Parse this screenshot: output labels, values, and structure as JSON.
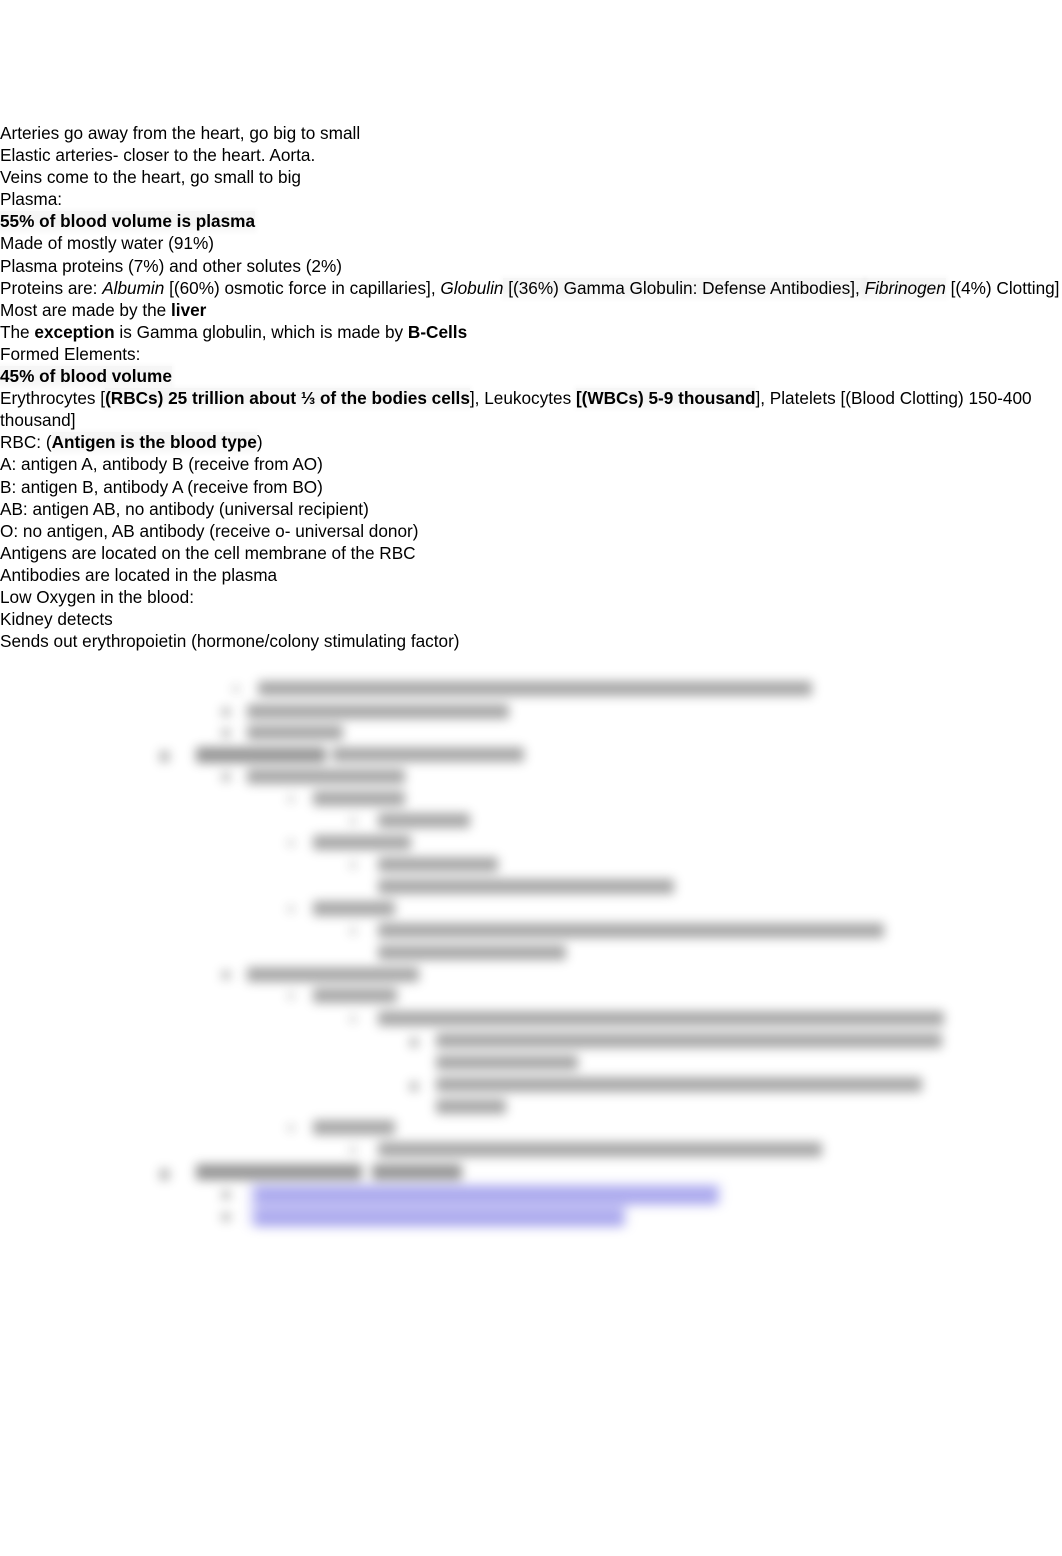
{
  "document": {
    "title": "Blood & Cardiovascular Study Notes",
    "page_background": "#ffffff",
    "text_color": "#000000",
    "highlight_color": "#8f8bf0",
    "blur_note": "lower portion of the page is heavily blurred and unreadable"
  },
  "bullets": {
    "level1": "➔",
    "level2": "◆",
    "level3": "●",
    "level4": "○"
  },
  "outline": {
    "arteries": "Arteries go away from the heart, go big to small",
    "arteries_sub": "Elastic arteries- closer to the heart. Aorta.",
    "veins": "Veins come to the heart, go small to big",
    "plasma_heading": "Plasma:",
    "plasma_volume": "55% of blood volume is plasma",
    "plasma_water": "Made of mostly water (91%)",
    "plasma_proteins": "Plasma proteins (7%)  and other solutes (2%)",
    "proteins_lead": "Proteins are: ",
    "proteins_albumin": "Albumin",
    "proteins_albumin_tail": " [(60%) osmotic force in capillaries], ",
    "proteins_globulin": "Globulin",
    "proteins_globulin_tail": " [(36%) Gamma Globulin: Defense Antibodies], ",
    "proteins_fibrinogen": "Fibrinogen",
    "proteins_fibrinogen_tail": " [(4%) Clotting]",
    "made_by_lead": "Most are made by the ",
    "made_by_liver": "liver",
    "exception_lead": "The ",
    "exception_word": "exception",
    "exception_mid": " is Gamma globulin, which is made by ",
    "exception_bcells": "B-Cells",
    "formed_elements_heading": "Formed Elements:",
    "formed_volume": "45% of blood volume",
    "formed_cells_lead": "Erythrocytes [",
    "formed_cells_rbc": "(RBCs) 25 trillion about ⅓ of the bodies cells",
    "formed_cells_mid": "], Leukocytes ",
    "formed_cells_wbc": "[(WBCs) 5-9 thousand",
    "formed_cells_tail": "], Platelets [(Blood Clotting) 150-400 thousand]",
    "rbc_lead": "RBC: (",
    "rbc_antigen": "Antigen is the blood type",
    "rbc_tail": ")",
    "type_a": "A: antigen A, antibody B (receive from AO)",
    "type_b": "B: antigen B, antibody A (receive from BO)",
    "type_ab": "AB: antigen AB, no antibody (universal recipient)",
    "type_o": "O: no antigen, AB antibody (receive o- universal donor)",
    "antigens_location": "Antigens are located on the cell membrane of the RBC",
    "antibodies_location": "Antibodies are located in the plasma",
    "low_oxygen_heading": "Low Oxygen in the blood:",
    "low_oxygen_kidney": "Kidney detects",
    "low_oxygen_epo": "Sends out erythropoietin (hormone/colony stimulating factor)"
  }
}
